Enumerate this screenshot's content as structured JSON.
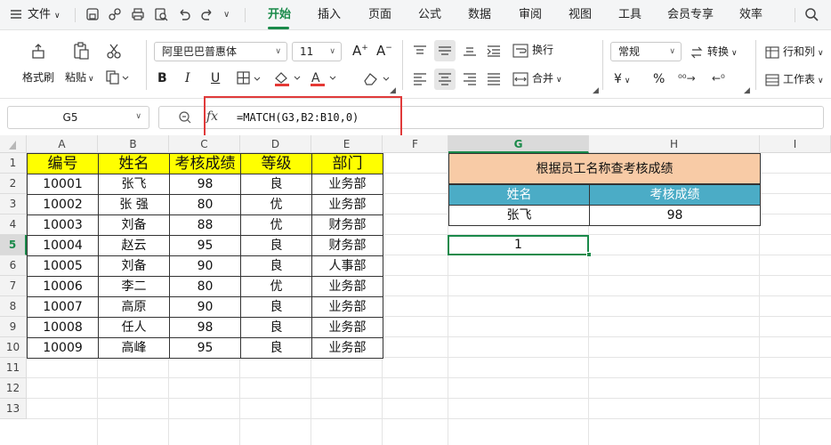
{
  "menu": {
    "file": "文件",
    "tabs": [
      "开始",
      "插入",
      "页面",
      "公式",
      "数据",
      "审阅",
      "视图",
      "工具",
      "会员专享",
      "效率"
    ]
  },
  "ribbon": {
    "format_painter": "格式刷",
    "paste": "粘贴",
    "font_name": "阿里巴巴普惠体",
    "font_size": "11",
    "increase_font": "A",
    "decrease_font": "A",
    "bold": "B",
    "italic": "I",
    "underline": "U",
    "fill_color": "#e53935",
    "font_color": "#e53935",
    "wrap": "换行",
    "merge": "合并",
    "number_format": "常规",
    "convert": "转换",
    "currency": "¥",
    "percent": "%",
    "rows_cols": "行和列",
    "worksheet": "工作表"
  },
  "formula_bar": {
    "name_box": "G5",
    "fx": "fx",
    "formula": "=MATCH(G3,B2:B10,0)"
  },
  "grid": {
    "columns": [
      "A",
      "B",
      "C",
      "D",
      "E",
      "F",
      "G",
      "H",
      "I"
    ],
    "rows": [
      "1",
      "2",
      "3",
      "4",
      "5",
      "6",
      "7",
      "8",
      "9",
      "10",
      "11",
      "12",
      "13"
    ],
    "selected_col": "G",
    "selected_row": "5",
    "colors": {
      "header_yellow": "#ffff00",
      "lookup_title_fill": "#f8cba6",
      "lookup_header_fill": "#4bacc6",
      "selection": "#1a8a4a"
    }
  },
  "table": {
    "headers": [
      "编号",
      "姓名",
      "考核成绩",
      "等级",
      "部门"
    ],
    "rows": [
      [
        "10001",
        "张飞",
        "98",
        "良",
        "业务部"
      ],
      [
        "10002",
        "张 强",
        "80",
        "优",
        "业务部"
      ],
      [
        "10003",
        "刘备",
        "88",
        "优",
        "财务部"
      ],
      [
        "10004",
        "赵云",
        "95",
        "良",
        "财务部"
      ],
      [
        "10005",
        "刘备",
        "90",
        "良",
        "人事部"
      ],
      [
        "10006",
        "李二",
        "80",
        "优",
        "业务部"
      ],
      [
        "10007",
        "高原",
        "90",
        "良",
        "业务部"
      ],
      [
        "10008",
        "任人",
        "98",
        "良",
        "业务部"
      ],
      [
        "10009",
        "高峰",
        "95",
        "良",
        "业务部"
      ]
    ]
  },
  "lookup": {
    "title": "根据员工名称查考核成绩",
    "headers": [
      "姓名",
      "考核成绩"
    ],
    "values": [
      "张飞",
      "98"
    ],
    "result": "1"
  }
}
